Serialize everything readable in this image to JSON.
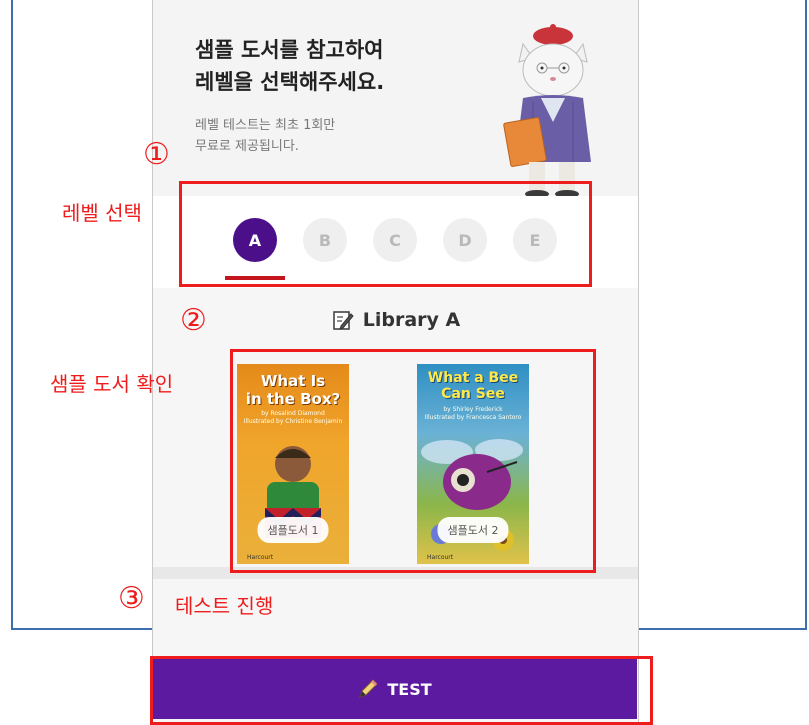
{
  "header": {
    "title_line1": "샘플 도서를 참고하여",
    "title_line2": "레벨을 선택해주세요.",
    "subtitle_line1": "레벨 테스트는 최초 1회만",
    "subtitle_line2": "무료로 제공됩니다."
  },
  "levels": {
    "items": [
      {
        "label": "A",
        "selected": true
      },
      {
        "label": "B",
        "selected": false
      },
      {
        "label": "C",
        "selected": false
      },
      {
        "label": "D",
        "selected": false
      },
      {
        "label": "E",
        "selected": false
      }
    ]
  },
  "library": {
    "title": "Library A",
    "icon": "pencil-edit-icon"
  },
  "books": [
    {
      "title_line1": "What Is",
      "title_line2": "in the Box?",
      "author": "by Rosalind Diamond",
      "illustrator": "Illustrated by Christine Benjamin",
      "label": "샘플도서 1",
      "publisher": "Harcourt"
    },
    {
      "title_line1": "What a Bee",
      "title_line2": "Can See",
      "author": "by Shirley Frederick",
      "illustrator": "Illustrated by Francesca Santoro",
      "label": "샘플도서 2",
      "publisher": "Harcourt"
    }
  ],
  "test_button": {
    "label": "TEST",
    "icon": "pencil-icon"
  },
  "annotations": {
    "step1_num": "①",
    "step1_label": "레벨 선택",
    "step2_num": "②",
    "step2_label": "샘플 도서 확인",
    "step3_num": "③",
    "step3_label": "테스트 진행",
    "color": "#ee1c1c"
  },
  "colors": {
    "accent": "#4b0f8a",
    "button": "#5b1aa0",
    "underline": "#c4151c"
  }
}
